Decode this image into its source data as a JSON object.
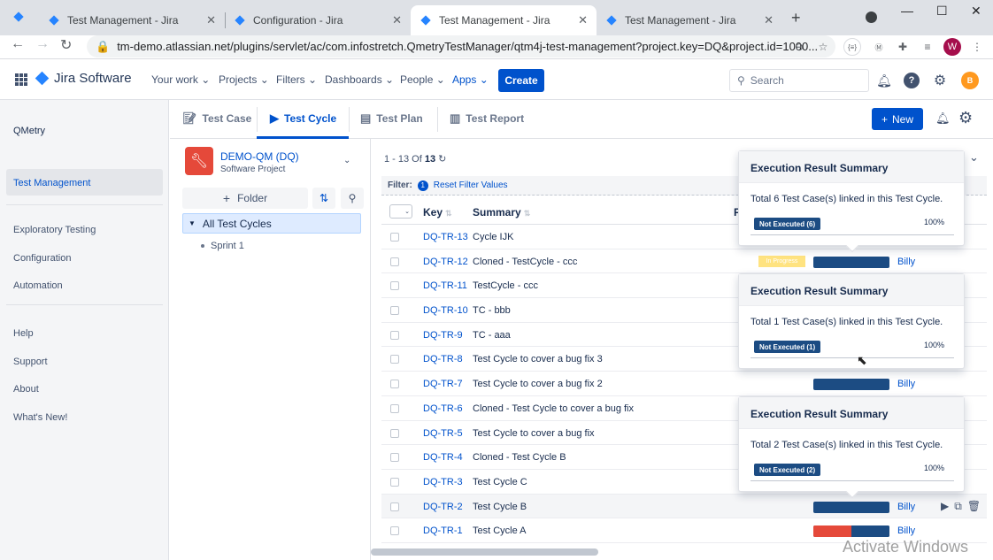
{
  "browser": {
    "tabs": [
      {
        "title": "Test Management - Jira",
        "active": false
      },
      {
        "title": "Configuration - Jira",
        "active": false
      },
      {
        "title": "Test Management - Jira",
        "active": true
      },
      {
        "title": "Test Management - Jira",
        "active": false
      }
    ],
    "url": "tm-demo.atlassian.net/plugins/servlet/ac/com.infostretch.QmetryTestManager/qtm4j-test-management?project.key=DQ&project.id=1000...",
    "profile_initial": "W"
  },
  "jira": {
    "product": "Jira Software",
    "nav": [
      "Your work",
      "Projects",
      "Filters",
      "Dashboards",
      "People",
      "Apps"
    ],
    "create_label": "Create",
    "search_placeholder": "Search",
    "user_initial": "B"
  },
  "left_nav": {
    "app_name": "QMetry",
    "items": [
      "Test Management",
      "Exploratory Testing",
      "Configuration",
      "Automation",
      "Help",
      "Support",
      "About",
      "What's New!"
    ]
  },
  "module_tabs": [
    "Test Case",
    "Test Cycle",
    "Test Plan",
    "Test Report"
  ],
  "new_label": "New",
  "project": {
    "name": "DEMO-QM (DQ)",
    "type": "Software Project"
  },
  "tree": {
    "folder_label": "Folder",
    "root": "All Test Cycles",
    "children": [
      "Sprint 1"
    ]
  },
  "table": {
    "pager_prefix": "1 - 13 Of",
    "pager_total": "13",
    "filter_label": "Filter:",
    "filter_count": "1",
    "reset_label": "Reset Filter Values",
    "headers": {
      "key": "Key",
      "summary": "Summary",
      "p": "P"
    },
    "rows": [
      {
        "key": "DQ-TR-13",
        "summary": "Cycle IJK",
        "assignee": ""
      },
      {
        "key": "DQ-TR-12",
        "summary": "Cloned - TestCycle - ccc",
        "assignee": "Billy",
        "status": "In Progress"
      },
      {
        "key": "DQ-TR-11",
        "summary": "TestCycle - ccc",
        "assignee": ""
      },
      {
        "key": "DQ-TR-10",
        "summary": "TC - bbb",
        "assignee": ""
      },
      {
        "key": "DQ-TR-9",
        "summary": "TC - aaa",
        "assignee": ""
      },
      {
        "key": "DQ-TR-8",
        "summary": "Test Cycle to cover a bug fix 3",
        "assignee": ""
      },
      {
        "key": "DQ-TR-7",
        "summary": "Test Cycle to cover a bug fix 2",
        "assignee": "Billy"
      },
      {
        "key": "DQ-TR-6",
        "summary": "Cloned - Test Cycle to cover a bug fix",
        "assignee": ""
      },
      {
        "key": "DQ-TR-5",
        "summary": "Test Cycle to cover a bug fix",
        "assignee": ""
      },
      {
        "key": "DQ-TR-4",
        "summary": "Cloned - Test Cycle B",
        "assignee": ""
      },
      {
        "key": "DQ-TR-3",
        "summary": "Test Cycle C",
        "assignee": ""
      },
      {
        "key": "DQ-TR-2",
        "summary": "Test Cycle B",
        "assignee": "Billy"
      },
      {
        "key": "DQ-TR-1",
        "summary": "Test Cycle A",
        "assignee": "Billy"
      }
    ]
  },
  "popovers": [
    {
      "title": "Execution Result Summary",
      "text": "Total 6 Test Case(s) linked in this Test Cycle.",
      "badge": "Not Executed (6)",
      "pct": "100%"
    },
    {
      "title": "Execution Result Summary",
      "text": "Total 1 Test Case(s) linked in this Test Cycle.",
      "badge": "Not Executed (1)",
      "pct": "100%"
    },
    {
      "title": "Execution Result Summary",
      "text": "Total 2 Test Case(s) linked in this Test Cycle.",
      "badge": "Not Executed (2)",
      "pct": "100%"
    }
  ],
  "watermark": "Activate Windows",
  "colors": {
    "accent": "#0052cc",
    "not_executed": "#1c4c83",
    "fail": "#e5493a",
    "in_progress": "#ffe380"
  }
}
